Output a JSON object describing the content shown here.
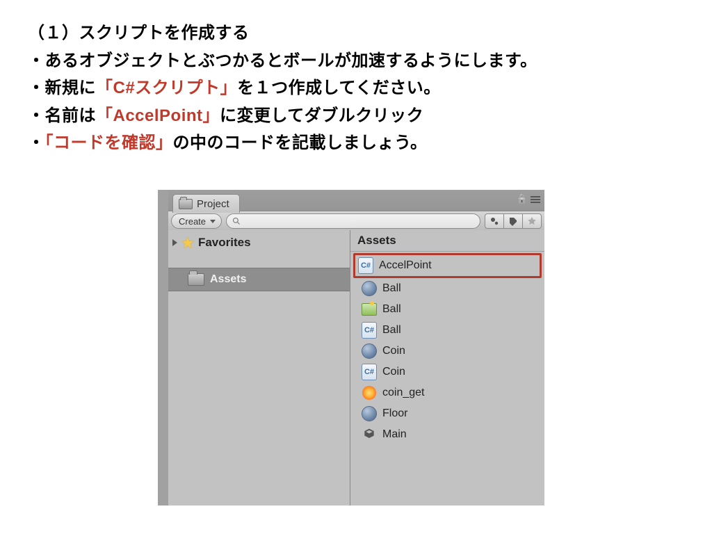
{
  "text": {
    "line1": "（１）スクリプトを作成する",
    "line2_pre": "・あるオブジェクトとぶつかるとボールが加速するようにします。",
    "line3_pre": "・新規に",
    "line3_red": "「C#スクリプト」",
    "line3_post": "を１つ作成してください。",
    "line4_pre": "・名前は",
    "line4_red": "「AccelPoint」",
    "line4_post": "に変更してダブルクリック",
    "line5_pre": "・",
    "line5_red": "「コードを確認」",
    "line5_post": "の中のコードを記載しましょう。"
  },
  "panel": {
    "tab": "Project",
    "create": "Create",
    "search_placeholder": "",
    "left": {
      "favorites": "Favorites",
      "assets": "Assets"
    },
    "right": {
      "header": "Assets",
      "items": [
        {
          "name": "AccelPoint",
          "kind": "cs",
          "hl": true
        },
        {
          "name": "Ball",
          "kind": "ball",
          "hl": false
        },
        {
          "name": "Ball",
          "kind": "scene",
          "hl": false
        },
        {
          "name": "Ball",
          "kind": "cs",
          "hl": false
        },
        {
          "name": "Coin",
          "kind": "ball",
          "hl": false
        },
        {
          "name": "Coin",
          "kind": "cs",
          "hl": false
        },
        {
          "name": "coin_get",
          "kind": "fx",
          "hl": false
        },
        {
          "name": "Floor",
          "kind": "ball",
          "hl": false
        },
        {
          "name": "Main",
          "kind": "unity",
          "hl": false
        }
      ]
    }
  }
}
